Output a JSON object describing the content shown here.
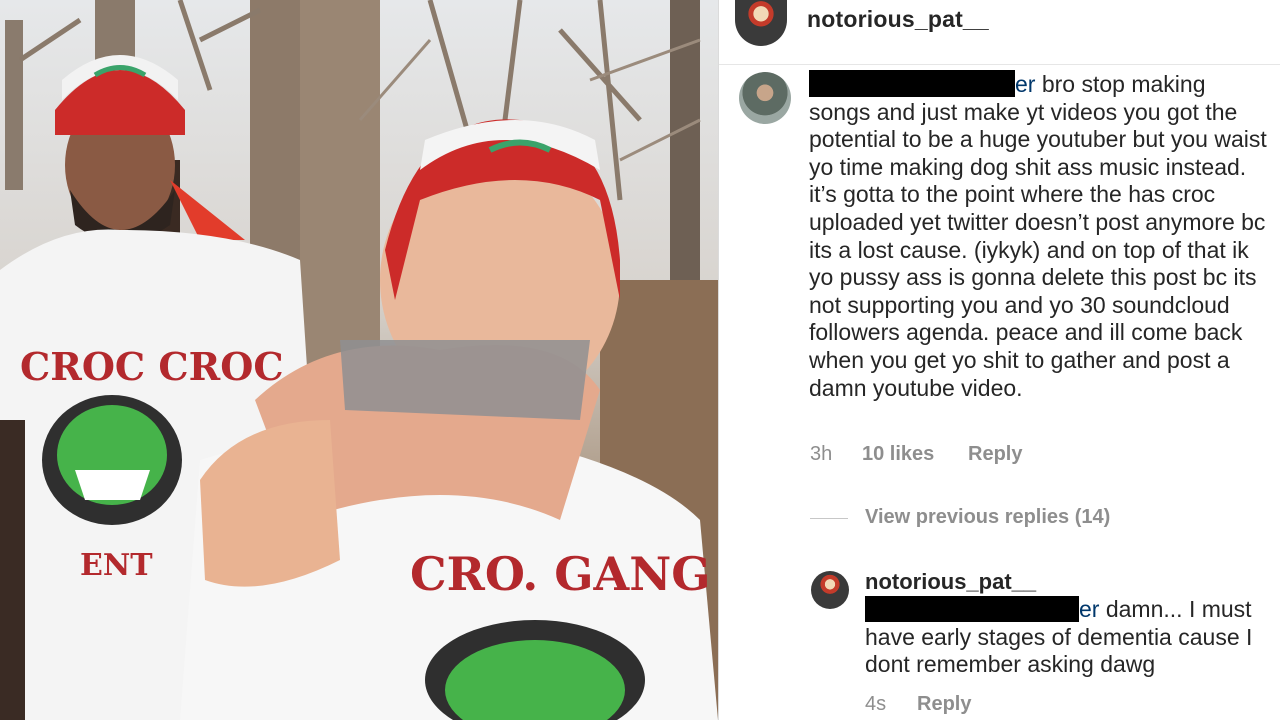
{
  "photo": {
    "shirt_left_top": "CROC CROC",
    "shirt_left_bottom": "ENT",
    "shirt_right_top": "CRO. GANG"
  },
  "header": {
    "username": "notorious_pat__"
  },
  "comment": {
    "mention_suffix": "er",
    "text": " bro stop making songs and just make yt videos you got the potential to be a huge youtuber but you waist yo time making dog shit ass music instead. it’s gotta to the point where the has croc uploaded yet twitter doesn’t post anymore bc its a lost cause. (iykyk) and on top of that ik yo pussy ass is gonna delete this post bc its not supporting you and yo 30 soundcloud followers agenda. peace and ill come back when you get yo shit to gather and post a damn youtube video.",
    "time": "3h",
    "likes": "10 likes",
    "reply": "Reply"
  },
  "view_replies": "View previous replies (14)",
  "reply": {
    "username": "notorious_pat__",
    "mention_suffix": "er",
    "text": " damn... I must have early stages of dementia cause I dont remember asking dawg",
    "time": "4s",
    "reply": "Reply"
  },
  "colors": {
    "text": "#262626",
    "muted": "#8e8e8e",
    "mention": "#00376b",
    "divider": "#dbdbdb"
  }
}
